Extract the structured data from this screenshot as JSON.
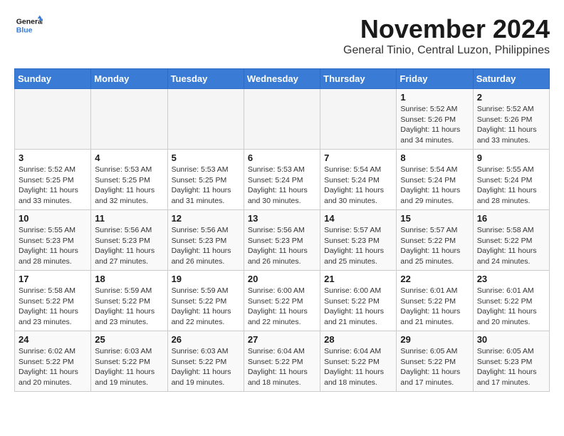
{
  "header": {
    "logo_line1": "General",
    "logo_line2": "Blue",
    "month_title": "November 2024",
    "subtitle": "General Tinio, Central Luzon, Philippines"
  },
  "days_of_week": [
    "Sunday",
    "Monday",
    "Tuesday",
    "Wednesday",
    "Thursday",
    "Friday",
    "Saturday"
  ],
  "weeks": [
    [
      {
        "day": "",
        "info": ""
      },
      {
        "day": "",
        "info": ""
      },
      {
        "day": "",
        "info": ""
      },
      {
        "day": "",
        "info": ""
      },
      {
        "day": "",
        "info": ""
      },
      {
        "day": "1",
        "info": "Sunrise: 5:52 AM\nSunset: 5:26 PM\nDaylight: 11 hours\nand 34 minutes."
      },
      {
        "day": "2",
        "info": "Sunrise: 5:52 AM\nSunset: 5:26 PM\nDaylight: 11 hours\nand 33 minutes."
      }
    ],
    [
      {
        "day": "3",
        "info": "Sunrise: 5:52 AM\nSunset: 5:25 PM\nDaylight: 11 hours\nand 33 minutes."
      },
      {
        "day": "4",
        "info": "Sunrise: 5:53 AM\nSunset: 5:25 PM\nDaylight: 11 hours\nand 32 minutes."
      },
      {
        "day": "5",
        "info": "Sunrise: 5:53 AM\nSunset: 5:25 PM\nDaylight: 11 hours\nand 31 minutes."
      },
      {
        "day": "6",
        "info": "Sunrise: 5:53 AM\nSunset: 5:24 PM\nDaylight: 11 hours\nand 30 minutes."
      },
      {
        "day": "7",
        "info": "Sunrise: 5:54 AM\nSunset: 5:24 PM\nDaylight: 11 hours\nand 30 minutes."
      },
      {
        "day": "8",
        "info": "Sunrise: 5:54 AM\nSunset: 5:24 PM\nDaylight: 11 hours\nand 29 minutes."
      },
      {
        "day": "9",
        "info": "Sunrise: 5:55 AM\nSunset: 5:24 PM\nDaylight: 11 hours\nand 28 minutes."
      }
    ],
    [
      {
        "day": "10",
        "info": "Sunrise: 5:55 AM\nSunset: 5:23 PM\nDaylight: 11 hours\nand 28 minutes."
      },
      {
        "day": "11",
        "info": "Sunrise: 5:56 AM\nSunset: 5:23 PM\nDaylight: 11 hours\nand 27 minutes."
      },
      {
        "day": "12",
        "info": "Sunrise: 5:56 AM\nSunset: 5:23 PM\nDaylight: 11 hours\nand 26 minutes."
      },
      {
        "day": "13",
        "info": "Sunrise: 5:56 AM\nSunset: 5:23 PM\nDaylight: 11 hours\nand 26 minutes."
      },
      {
        "day": "14",
        "info": "Sunrise: 5:57 AM\nSunset: 5:23 PM\nDaylight: 11 hours\nand 25 minutes."
      },
      {
        "day": "15",
        "info": "Sunrise: 5:57 AM\nSunset: 5:22 PM\nDaylight: 11 hours\nand 25 minutes."
      },
      {
        "day": "16",
        "info": "Sunrise: 5:58 AM\nSunset: 5:22 PM\nDaylight: 11 hours\nand 24 minutes."
      }
    ],
    [
      {
        "day": "17",
        "info": "Sunrise: 5:58 AM\nSunset: 5:22 PM\nDaylight: 11 hours\nand 23 minutes."
      },
      {
        "day": "18",
        "info": "Sunrise: 5:59 AM\nSunset: 5:22 PM\nDaylight: 11 hours\nand 23 minutes."
      },
      {
        "day": "19",
        "info": "Sunrise: 5:59 AM\nSunset: 5:22 PM\nDaylight: 11 hours\nand 22 minutes."
      },
      {
        "day": "20",
        "info": "Sunrise: 6:00 AM\nSunset: 5:22 PM\nDaylight: 11 hours\nand 22 minutes."
      },
      {
        "day": "21",
        "info": "Sunrise: 6:00 AM\nSunset: 5:22 PM\nDaylight: 11 hours\nand 21 minutes."
      },
      {
        "day": "22",
        "info": "Sunrise: 6:01 AM\nSunset: 5:22 PM\nDaylight: 11 hours\nand 21 minutes."
      },
      {
        "day": "23",
        "info": "Sunrise: 6:01 AM\nSunset: 5:22 PM\nDaylight: 11 hours\nand 20 minutes."
      }
    ],
    [
      {
        "day": "24",
        "info": "Sunrise: 6:02 AM\nSunset: 5:22 PM\nDaylight: 11 hours\nand 20 minutes."
      },
      {
        "day": "25",
        "info": "Sunrise: 6:03 AM\nSunset: 5:22 PM\nDaylight: 11 hours\nand 19 minutes."
      },
      {
        "day": "26",
        "info": "Sunrise: 6:03 AM\nSunset: 5:22 PM\nDaylight: 11 hours\nand 19 minutes."
      },
      {
        "day": "27",
        "info": "Sunrise: 6:04 AM\nSunset: 5:22 PM\nDaylight: 11 hours\nand 18 minutes."
      },
      {
        "day": "28",
        "info": "Sunrise: 6:04 AM\nSunset: 5:22 PM\nDaylight: 11 hours\nand 18 minutes."
      },
      {
        "day": "29",
        "info": "Sunrise: 6:05 AM\nSunset: 5:22 PM\nDaylight: 11 hours\nand 17 minutes."
      },
      {
        "day": "30",
        "info": "Sunrise: 6:05 AM\nSunset: 5:23 PM\nDaylight: 11 hours\nand 17 minutes."
      }
    ]
  ]
}
